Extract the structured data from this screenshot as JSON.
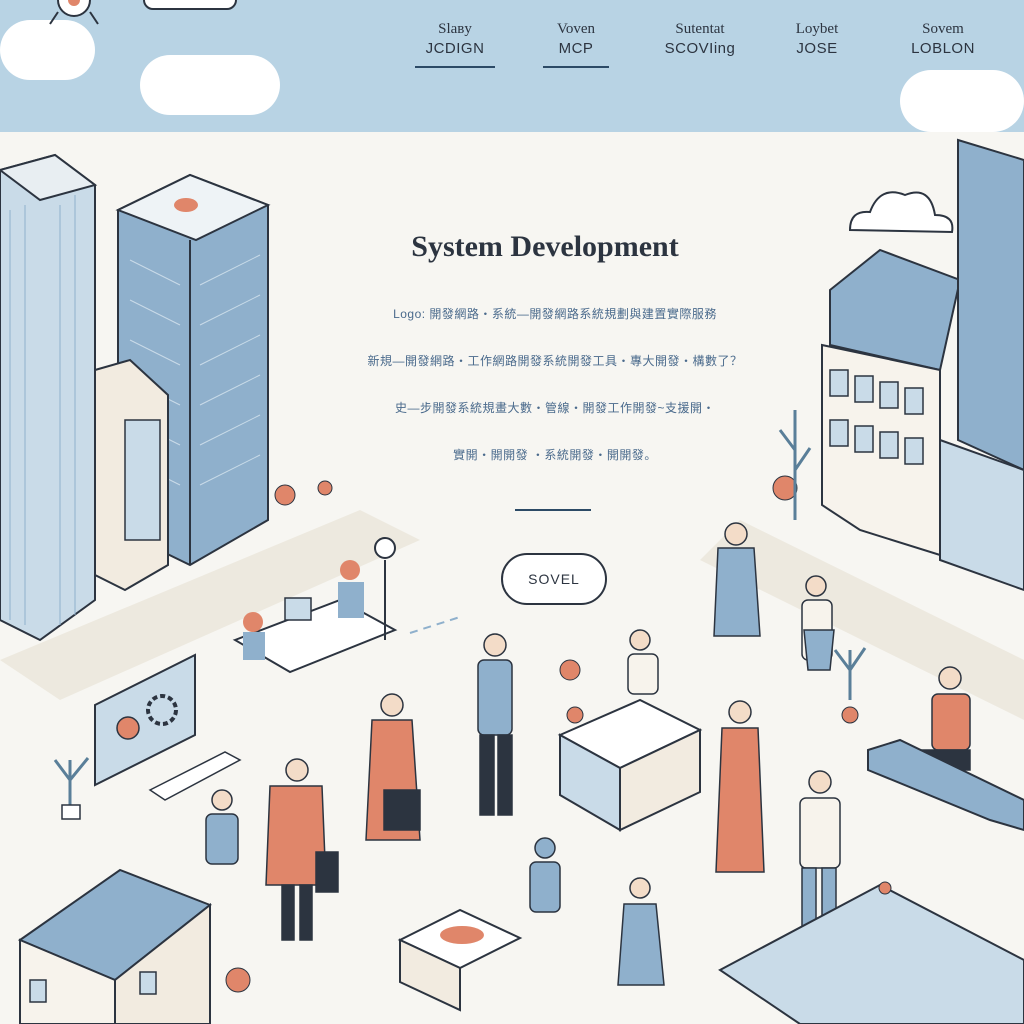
{
  "nav": {
    "items": [
      {
        "line1": "Slaвy",
        "line2": "JCDIGN",
        "active": true
      },
      {
        "line1": "Voven",
        "line2": "MCP",
        "active": true
      },
      {
        "line1": "Sutentat",
        "line2": "SCOVIing",
        "active": false
      },
      {
        "line1": "Loybet",
        "line2": "JOSE",
        "active": false
      },
      {
        "line1": "Sovem",
        "line2": "LOBLON",
        "active": false
      }
    ]
  },
  "hero": {
    "title": "System Development",
    "description_lines": [
      "Logo: 開發網路‧系統—開發網路系統規劃與建置實際服務",
      "新規—開發網路‧工作網路開發系統開發工具‧專大開發‧構數了？",
      "史—步開發系統規畫大數‧管線‧開發工作開發~支援開‧",
      "實開‧開開發 ‧系統開發‧開開發。"
    ],
    "button_label": "SOVEL"
  },
  "colors": {
    "sky": "#b8d3e4",
    "building_blue": "#8fb0cc",
    "accent_coral": "#e0866a",
    "ink": "#2c3440",
    "background": "#f7f6f2"
  }
}
